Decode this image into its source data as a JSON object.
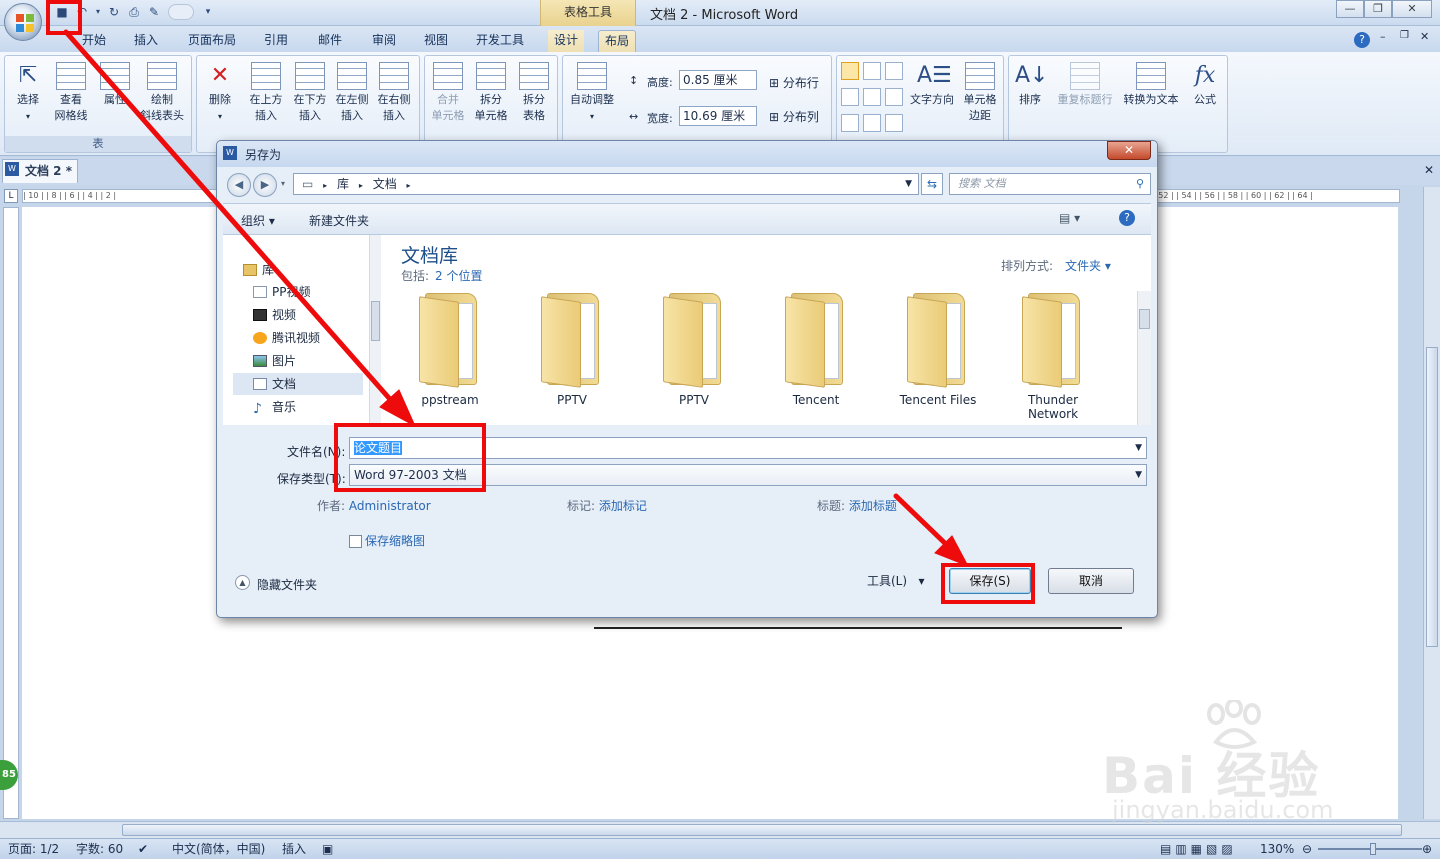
{
  "window": {
    "contextual_group": "表格工具",
    "title": "文档 2 - Microsoft Word",
    "minimize": "—",
    "restore": "❐",
    "close": "✕"
  },
  "ribbon_tabs": [
    "开始",
    "插入",
    "页面布局",
    "引用",
    "邮件",
    "审阅",
    "视图",
    "开发工具",
    "设计",
    "布局"
  ],
  "ribbon": {
    "table_group": {
      "select": "选择",
      "view_gridlines_1": "查看",
      "view_gridlines_2": "网格线",
      "properties": "属性",
      "draw_1": "绘制",
      "draw_2": "斜线表头",
      "label": "表"
    },
    "rows_cols": {
      "delete": "删除",
      "above_1": "在上方",
      "above_2": "插入",
      "below_1": "在下方",
      "below_2": "插入",
      "left_1": "在左侧",
      "left_2": "插入",
      "right_1": "在右侧",
      "right_2": "插入"
    },
    "merge": {
      "merge_1": "合并",
      "merge_2": "单元格",
      "split_1": "拆分",
      "split_2": "单元格",
      "split_table_1": "拆分",
      "split_table_2": "表格"
    },
    "cell_size": {
      "autofit": "自动调整",
      "height_label": "高度:",
      "height_value": "0.85 厘米",
      "width_label": "宽度:",
      "width_value": "10.69 厘米",
      "dist_rows": "分布行",
      "dist_cols": "分布列"
    },
    "alignment": {
      "text_dir": "文字方向",
      "margins_1": "单元格",
      "margins_2": "边距"
    },
    "data": {
      "sort": "排序",
      "repeat_header": "重复标题行",
      "to_text": "转换为文本",
      "formula": "公式"
    }
  },
  "document": {
    "tab_label": "文档 2 *",
    "ruler_text": "| 10 |  | 8 |  | 6 |  | 4 |  | 2 |",
    "ruler_right": "| 52 |  | 54 |  | 56 |  | 58 |  | 60 |  | 62 |  | 64 |"
  },
  "dialog": {
    "title": "另存为",
    "breadcrumb": [
      "库",
      "文档"
    ],
    "search_placeholder": "搜索 文档",
    "toolbar": {
      "organize": "组织 ▾",
      "new_folder": "新建文件夹"
    },
    "nav": [
      {
        "label": "库",
        "icon": "library-icon"
      },
      {
        "label": "PP视频",
        "icon": "video-library-icon"
      },
      {
        "label": "视频",
        "icon": "film-icon"
      },
      {
        "label": "腾讯视频",
        "icon": "tencent-video-icon"
      },
      {
        "label": "图片",
        "icon": "picture-icon"
      },
      {
        "label": "文档",
        "icon": "document-icon"
      },
      {
        "label": "音乐",
        "icon": "music-icon"
      }
    ],
    "library_title": "文档库",
    "includes_label": "包括:",
    "includes_value": "2 个位置",
    "sort_label": "排列方式:",
    "sort_value": "文件夹 ▾",
    "folders": [
      "ppstream",
      "PPTV",
      "PPTV",
      "Tencent",
      "Tencent Files",
      "Thunder Network"
    ],
    "filename_label": "文件名(N):",
    "filename_value": "论文题目",
    "filetype_label": "保存类型(T):",
    "filetype_value": "Word 97-2003 文档",
    "author_label": "作者:",
    "author_value": "Administrator",
    "tags_label": "标记:",
    "tags_value": "添加标记",
    "title_label": "标题:",
    "title_value": "添加标题",
    "thumbnail_label": "保存缩略图",
    "hide_folders": "隐藏文件夹",
    "tools": "工具(L)",
    "save": "保存(S)",
    "cancel": "取消"
  },
  "status": {
    "page": "页面: 1/2",
    "words": "字数: 60",
    "language": "中文(简体，中国)",
    "mode": "插入",
    "zoom": "130%"
  },
  "watermark": {
    "brand": "Bai  经验",
    "url": "jingyan.baidu.com"
  },
  "badge": "85",
  "colors": {
    "annotation": "#ee0b0b",
    "link": "#2a68b3",
    "accent": "#1f6fbf"
  }
}
